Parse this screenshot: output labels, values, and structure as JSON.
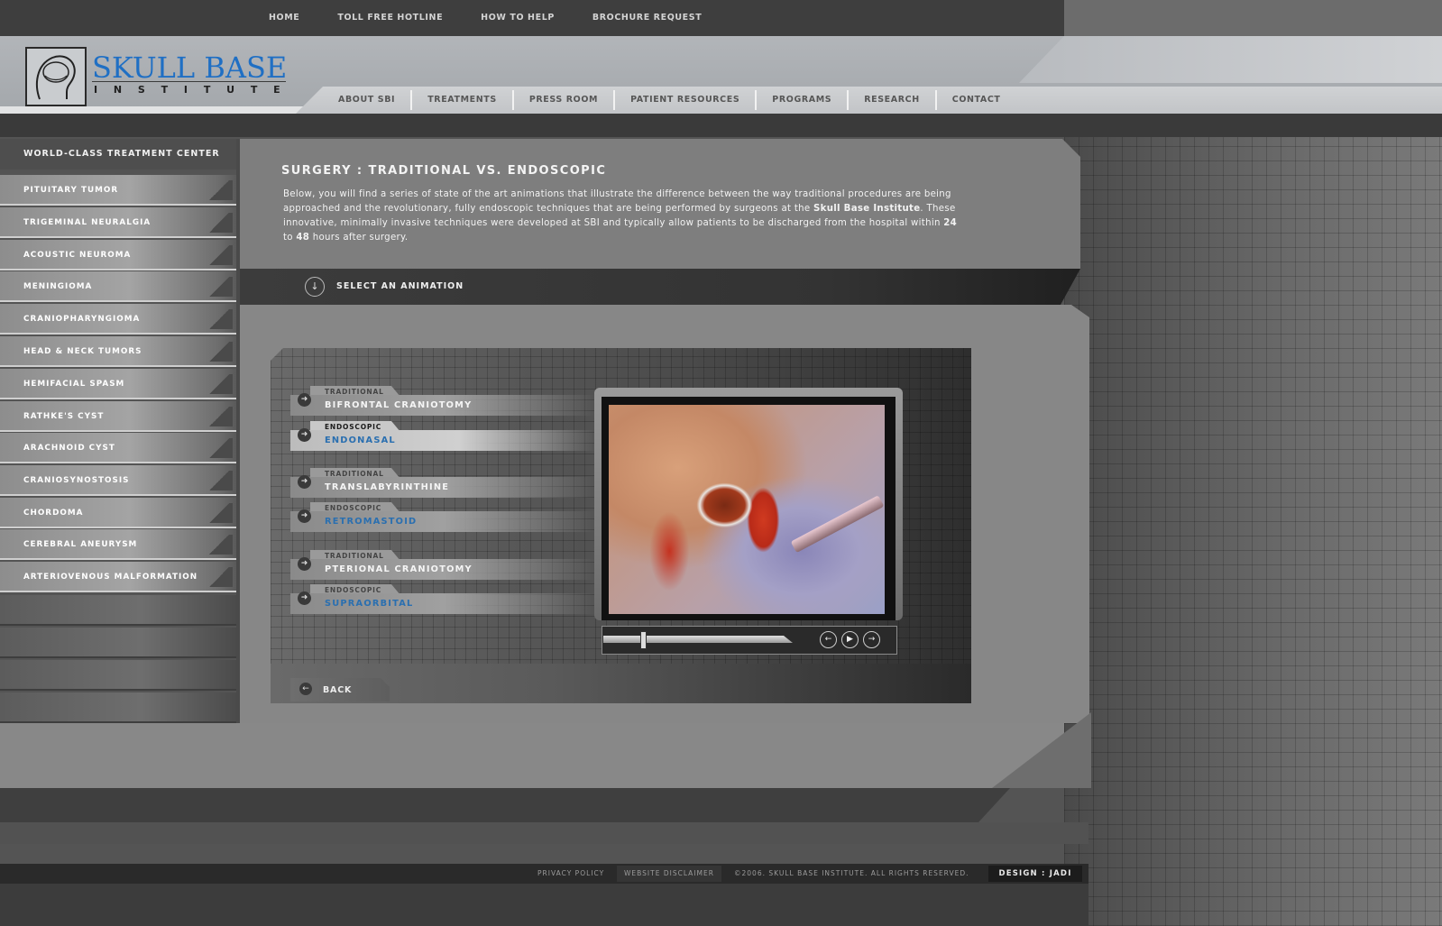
{
  "top_links": [
    "HOME",
    "TOLL FREE HOTLINE",
    "HOW TO HELP",
    "BROCHURE REQUEST"
  ],
  "logo": {
    "title": "SKULL BASE",
    "subtitle": "INSTITUTE"
  },
  "main_nav": [
    "ABOUT SBI",
    "TREATMENTS",
    "PRESS ROOM",
    "PATIENT RESOURCES",
    "PROGRAMS",
    "RESEARCH",
    "CONTACT"
  ],
  "sidebar": {
    "heading": "WORLD-CLASS TREATMENT CENTER",
    "items": [
      "PITUITARY TUMOR",
      "TRIGEMINAL NEURALGIA",
      "ACOUSTIC NEUROMA",
      "MENINGIOMA",
      "CRANIOPHARYNGIOMA",
      "HEAD & NECK TUMORS",
      "HEMIFACIAL SPASM",
      "RATHKE'S CYST",
      "ARACHNOID CYST",
      "CRANIOSYNOSTOSIS",
      "CHORDOMA",
      "CEREBRAL ANEURYSM",
      "ARTERIOVENOUS MALFORMATION"
    ]
  },
  "content": {
    "title": "SURGERY : TRADITIONAL VS. ENDOSCOPIC",
    "intro_1": "Below, you will find a series of state of the art animations that illustrate the difference between the way traditional procedures are being approached and the revolutionary, fully endoscopic techniques that are being performed by surgeons at the ",
    "intro_bold_1": "Skull Base Institute",
    "intro_2": ". These innovative, minimally invasive techniques were developed at SBI and typically allow patients to be discharged from the hospital within ",
    "intro_bold_2": "24",
    "intro_3": " to ",
    "intro_bold_3": "48",
    "intro_4": " hours after surgery.",
    "select_label": "SELECT AN ANIMATION",
    "back_label": "BACK"
  },
  "animations": [
    {
      "type": "TRADITIONAL",
      "name": "BIFRONTAL CRANIOTOMY",
      "selected": false
    },
    {
      "type": "ENDOSCOPIC",
      "name": "ENDONASAL",
      "selected": true
    },
    {
      "type": "TRADITIONAL",
      "name": "TRANSLABYRINTHINE",
      "selected": false
    },
    {
      "type": "ENDOSCOPIC",
      "name": "RETROMASTOID",
      "selected": false
    },
    {
      "type": "TRADITIONAL",
      "name": "PTERIONAL CRANIOTOMY",
      "selected": false
    },
    {
      "type": "ENDOSCOPIC",
      "name": "SUPRAORBITAL",
      "selected": false
    }
  ],
  "player": {
    "progress": 0.2
  },
  "footer": {
    "privacy": "PRIVACY POLICY",
    "disclaimer": "WEBSITE DISCLAIMER",
    "copyright": "©2006. SKULL BASE INSTITUTE. ALL RIGHTS RESERVED.",
    "design": "DESIGN : JADI"
  },
  "colors": {
    "brand_blue": "#1f6fc4",
    "link_blue": "#2a6fb0"
  }
}
